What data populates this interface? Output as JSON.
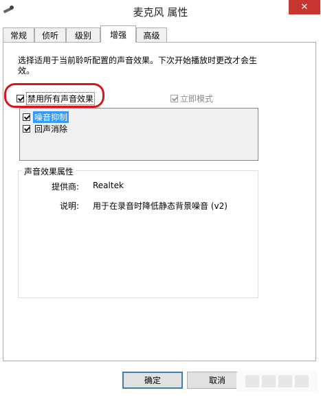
{
  "window": {
    "title": "麦克风 属性",
    "close_glyph": "✕"
  },
  "tabs": [
    {
      "label": "常规",
      "active": false
    },
    {
      "label": "侦听",
      "active": false
    },
    {
      "label": "级别",
      "active": false
    },
    {
      "label": "增强",
      "active": true
    },
    {
      "label": "高级",
      "active": false
    }
  ],
  "enhancements": {
    "description": "选择适用于当前聆听配置的声音效果。下次开始播放时更改才会生效。",
    "disable_all_label": "禁用所有声音效果",
    "disable_all_checked": true,
    "immediate_mode_label": "立即模式",
    "immediate_mode_checked": true,
    "immediate_mode_enabled": false,
    "effects": [
      {
        "label": "噪音抑制",
        "checked": true,
        "selected": true
      },
      {
        "label": "回声消除",
        "checked": true,
        "selected": false
      }
    ]
  },
  "properties": {
    "group_title": "声音效果属性",
    "provider_label": "提供商:",
    "provider_value": "Realtek",
    "description_label": "说明:",
    "description_value": "用于在录音时降低静态背景噪音 (v2)"
  },
  "buttons": {
    "ok": "确定",
    "cancel": "取消"
  },
  "colors": {
    "highlight_oval": "#d8141c",
    "selection": "#3399ff",
    "close_button": "#c7372f"
  }
}
